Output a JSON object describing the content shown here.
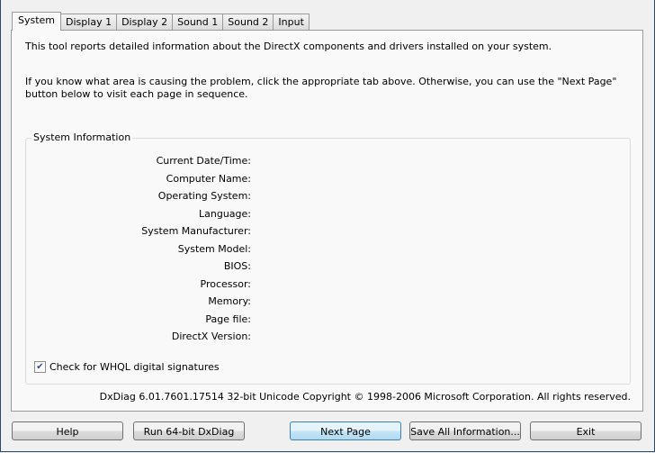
{
  "tabs": [
    "System",
    "Display 1",
    "Display 2",
    "Sound 1",
    "Sound 2",
    "Input"
  ],
  "intro": "This tool reports detailed information about the DirectX components and drivers installed on your system.",
  "instructions": "If you know what area is causing the problem, click the appropriate tab above.  Otherwise, you can use the \"Next Page\" button below to visit each page in sequence.",
  "group_title": "System Information",
  "fields": [
    "Current Date/Time:",
    "Computer Name:",
    "Operating System:",
    "Language:",
    "System Manufacturer:",
    "System Model:",
    "BIOS:",
    "Processor:",
    "Memory:",
    "Page file:",
    "DirectX Version:"
  ],
  "whql": {
    "label": "Check for WHQL digital signatures",
    "checked": true
  },
  "footer": "DxDiag 6.01.7601.17514 32-bit Unicode  Copyright © 1998-2006 Microsoft Corporation.  All rights reserved.",
  "buttons": {
    "help": "Help",
    "run64": "Run 64-bit DxDiag",
    "next": "Next Page",
    "save": "Save All Information...",
    "exit": "Exit"
  }
}
